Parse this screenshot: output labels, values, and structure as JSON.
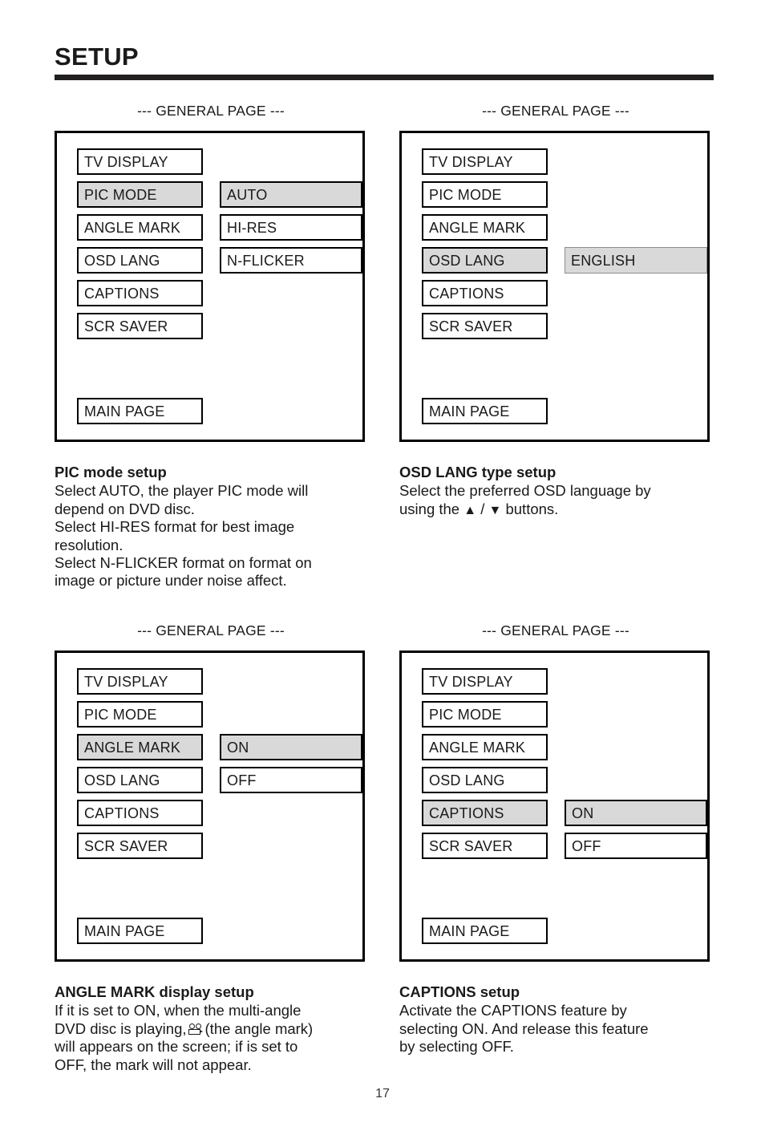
{
  "header": {
    "title": "SETUP"
  },
  "page_number": "17",
  "panels": [
    {
      "caption": "--- GENERAL PAGE ---",
      "rows": [
        {
          "label": "TV DISPLAY",
          "label_selected": false,
          "value": "",
          "value_selected": false,
          "has_value": false
        },
        {
          "label": "PIC MODE",
          "label_selected": true,
          "value": "AUTO",
          "value_selected": true,
          "has_value": true
        },
        {
          "label": "ANGLE MARK",
          "label_selected": false,
          "value": "HI-RES",
          "value_selected": false,
          "has_value": true
        },
        {
          "label": "OSD LANG",
          "label_selected": false,
          "value": "N-FLICKER",
          "value_selected": false,
          "has_value": true
        },
        {
          "label": "CAPTIONS",
          "label_selected": false,
          "value": "",
          "value_selected": false,
          "has_value": false
        },
        {
          "label": "SCR SAVER",
          "label_selected": false,
          "value": "",
          "value_selected": false,
          "has_value": false
        }
      ],
      "footer": "MAIN PAGE"
    },
    {
      "caption": "--- GENERAL PAGE ---",
      "rows": [
        {
          "label": "TV DISPLAY",
          "label_selected": false,
          "value": "",
          "value_selected": false,
          "has_value": false
        },
        {
          "label": "PIC MODE",
          "label_selected": false,
          "value": "",
          "value_selected": false,
          "has_value": false
        },
        {
          "label": "ANGLE MARK",
          "label_selected": false,
          "value": "",
          "value_selected": false,
          "has_value": false
        },
        {
          "label": "OSD LANG",
          "label_selected": true,
          "value": "ENGLISH",
          "value_selected": true,
          "has_value": true
        },
        {
          "label": "CAPTIONS",
          "label_selected": false,
          "value": "",
          "value_selected": false,
          "has_value": false
        },
        {
          "label": "SCR SAVER",
          "label_selected": false,
          "value": "",
          "value_selected": false,
          "has_value": false
        }
      ],
      "footer": "MAIN PAGE"
    },
    {
      "caption": "--- GENERAL PAGE ---",
      "rows": [
        {
          "label": "TV DISPLAY",
          "label_selected": false,
          "value": "",
          "value_selected": false,
          "has_value": false
        },
        {
          "label": "PIC MODE",
          "label_selected": false,
          "value": "",
          "value_selected": false,
          "has_value": false
        },
        {
          "label": "ANGLE MARK",
          "label_selected": true,
          "value": "ON",
          "value_selected": true,
          "has_value": true
        },
        {
          "label": "OSD LANG",
          "label_selected": false,
          "value": "OFF",
          "value_selected": false,
          "has_value": true
        },
        {
          "label": "CAPTIONS",
          "label_selected": false,
          "value": "",
          "value_selected": false,
          "has_value": false
        },
        {
          "label": "SCR SAVER",
          "label_selected": false,
          "value": "",
          "value_selected": false,
          "has_value": false
        }
      ],
      "footer": "MAIN PAGE"
    },
    {
      "caption": "--- GENERAL PAGE ---",
      "rows": [
        {
          "label": "TV DISPLAY",
          "label_selected": false,
          "value": "",
          "value_selected": false,
          "has_value": false
        },
        {
          "label": "PIC MODE",
          "label_selected": false,
          "value": "",
          "value_selected": false,
          "has_value": false
        },
        {
          "label": "ANGLE MARK",
          "label_selected": false,
          "value": "",
          "value_selected": false,
          "has_value": false
        },
        {
          "label": "OSD LANG",
          "label_selected": false,
          "value": "",
          "value_selected": false,
          "has_value": false
        },
        {
          "label": "CAPTIONS",
          "label_selected": true,
          "value": "ON",
          "value_selected": true,
          "has_value": true
        },
        {
          "label": "SCR SAVER",
          "label_selected": false,
          "value": "OFF",
          "value_selected": false,
          "has_value": true
        }
      ],
      "footer": "MAIN PAGE"
    }
  ],
  "descriptions": {
    "pic_mode": {
      "title": "PIC mode setup",
      "lines": [
        "Select AUTO, the player PIC mode will",
        "depend on DVD disc.",
        "Select HI-RES format for best image",
        "resolution.",
        "Select N-FLICKER format on format on",
        "image or picture under noise affect."
      ]
    },
    "osd_lang": {
      "title": "OSD LANG type setup",
      "line1": "Select the preferred OSD language by",
      "line2_prefix": "using the",
      "up_arrow": "▲",
      "separator": "/",
      "down_arrow": "▼",
      "line2_suffix": "buttons."
    },
    "angle_mark": {
      "title": "ANGLE MARK display setup",
      "line1": "If it is set to ON, when the multi-angle",
      "line2_prefix": "DVD disc is playing,",
      "icon_name": "movie-camera-angle-mark-icon",
      "line2_suffix": "(the angle mark)",
      "line3": "will appears on the screen; if is set to",
      "line4": "OFF, the mark will not appear."
    },
    "captions": {
      "title": "CAPTIONS setup",
      "lines": [
        "Activate the CAPTIONS feature by",
        "selecting ON.  And release this feature",
        "by selecting OFF."
      ]
    }
  },
  "colors": {
    "ink": "#1a1a1a",
    "rule": "#231f20",
    "highlight": "#d9d9d9",
    "border": "#000000"
  }
}
